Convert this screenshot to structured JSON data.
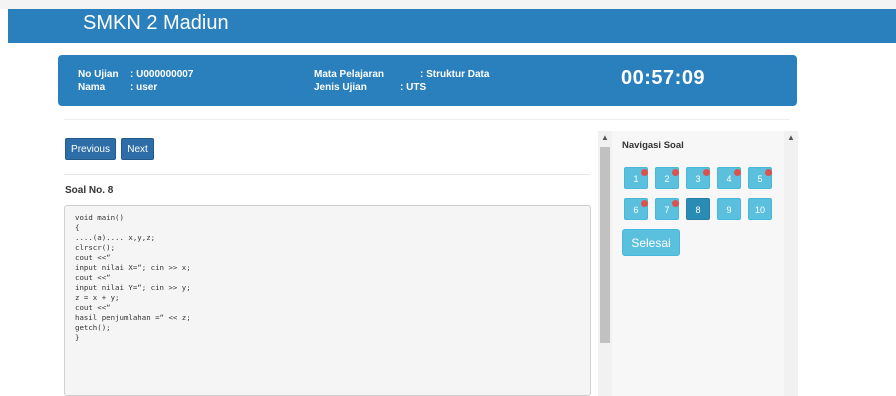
{
  "header": {
    "school": "SMKN 2 Madiun"
  },
  "exam_info": {
    "no_ujian_label": "No Ujian",
    "no_ujian_value": ": U000000007",
    "nama_label": "Nama",
    "nama_value": ": user",
    "mapel_label": "Mata Pelajaran",
    "mapel_value": ": Struktur Data",
    "jenis_label": "Jenis Ujian",
    "jenis_value": ": UTS",
    "timer": "00:57:09"
  },
  "controls": {
    "previous": "Previous",
    "next": "Next"
  },
  "question": {
    "title": "Soal No. 8",
    "code": "void main()\n{\n....(a).... x,y,z;\nclrscr();\ncout <<“\ninput nilai X=“; cin >> x;\ncout <<“\ninput nilai Y=“; cin >> y;\nz = x + y;\ncout <<“\nhasil penjumlahan =“ << z;\ngetch();\n}"
  },
  "navigation": {
    "title": "Navigasi Soal",
    "numbers": [
      {
        "label": "1",
        "answered": true
      },
      {
        "label": "2",
        "answered": true
      },
      {
        "label": "3",
        "answered": true
      },
      {
        "label": "4",
        "answered": true
      },
      {
        "label": "5",
        "answered": true
      },
      {
        "label": "6",
        "answered": true
      },
      {
        "label": "7",
        "answered": true
      },
      {
        "label": "8",
        "answered": false,
        "current": true
      },
      {
        "label": "9",
        "answered": false
      },
      {
        "label": "10",
        "answered": false
      }
    ],
    "finish": "Selesai"
  },
  "colors": {
    "primary": "#2a7fbd",
    "nav_button": "#5bc0de",
    "answered_dot": "#d9534f"
  }
}
